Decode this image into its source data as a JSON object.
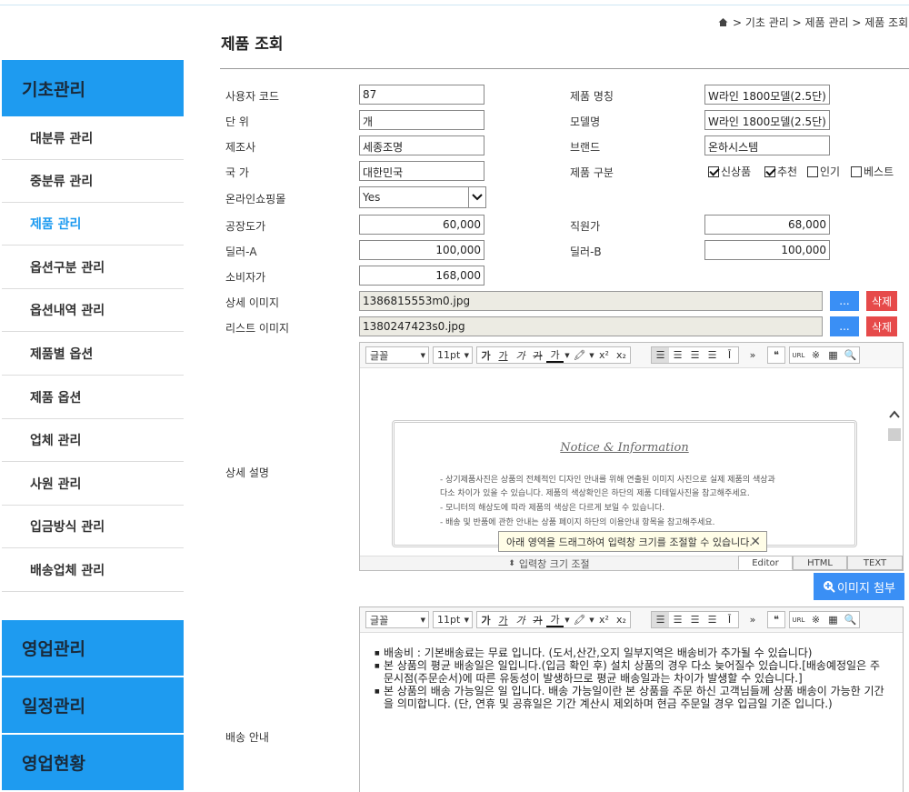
{
  "breadcrumb": {
    "items": [
      "기초 관리",
      "제품 관리",
      "제품 조회"
    ]
  },
  "page_title": "제품 조회",
  "sidebar": {
    "sections": [
      {
        "label": "기초관리"
      },
      {
        "label": "영업관리"
      },
      {
        "label": "일정관리"
      },
      {
        "label": "영업현황"
      }
    ],
    "items": [
      {
        "label": "대분류 관리"
      },
      {
        "label": "중분류 관리"
      },
      {
        "label": "제품 관리"
      },
      {
        "label": "옵션구분 관리"
      },
      {
        "label": "옵션내역 관리"
      },
      {
        "label": "제품별 옵션"
      },
      {
        "label": "제품 옵션"
      },
      {
        "label": "업체 관리"
      },
      {
        "label": "사원 관리"
      },
      {
        "label": "입금방식 관리"
      },
      {
        "label": "배송업체 관리"
      }
    ]
  },
  "form": {
    "user_code": {
      "label": "사용자 코드",
      "value": "87"
    },
    "unit": {
      "label": "단 위",
      "value": "개"
    },
    "maker": {
      "label": "제조사",
      "value": "세종조명"
    },
    "country": {
      "label": "국 가",
      "value": "대한민국"
    },
    "online_mall": {
      "label": "온라인쇼핑몰",
      "value": "Yes"
    },
    "factory_price": {
      "label": "공장도가",
      "value": "60,000"
    },
    "dealer_a": {
      "label": "딜러-A",
      "value": "100,000"
    },
    "consumer_price": {
      "label": "소비자가",
      "value": "168,000"
    },
    "product_name": {
      "label": "제품 명칭",
      "value": "W라인 1800모델(2.5단) ·"
    },
    "model_name": {
      "label": "모델명",
      "value": "W라인 1800모델(2.5단) ·"
    },
    "brand": {
      "label": "브랜드",
      "value": "온하시스템"
    },
    "product_type": {
      "label": "제품 구분",
      "options": [
        {
          "label": "신상품",
          "checked": true
        },
        {
          "label": "추천",
          "checked": true
        },
        {
          "label": "인기",
          "checked": false
        },
        {
          "label": "베스트",
          "checked": false
        }
      ]
    },
    "staff_price": {
      "label": "직원가",
      "value": "68,000"
    },
    "dealer_b": {
      "label": "딜러-B",
      "value": "100,000"
    },
    "detail_image": {
      "label": "상세 이미지",
      "value": "1386815553m0.jpg",
      "browse": "...",
      "delete": "삭제"
    },
    "list_image": {
      "label": "리스트 이미지",
      "value": "1380247423s0.jpg",
      "browse": "...",
      "delete": "삭제"
    },
    "detail_desc": {
      "label": "상세 설명"
    },
    "shipping_info": {
      "label": "배송 안내"
    },
    "attach_image": "이미지 첨부"
  },
  "editor": {
    "font": "글꼴",
    "size": "11pt",
    "notice_title": "Notice & Information",
    "notice_lines": [
      "- 상기제품사진은 상품의 전체적인 디자인 안내를 위해 연출된 이미지 사진으로 실제 제품의 색상과",
      "  다소 차이가 있을 수 있습니다. 제품의 색상확인은 하단의 제품 디테일사진을 참고해주세요.",
      "- 모니터의 해상도에 따라 제품의 색상은 다르게 보일 수 있습니다.",
      "- 배송 및 반품에 관한 안내는 상품 페이지 하단의 이용안내 항목을 참고해주세요."
    ],
    "tooltip": "아래 영역을 드래그하여 입력창 크기를 조절할 수 있습니다.",
    "resize_label": "입력창 크기 조절",
    "tabs": [
      "Editor",
      "HTML",
      "TEXT"
    ],
    "tb_glyphs": [
      "가",
      "가",
      "가",
      "가",
      "가",
      "가",
      "가",
      "가"
    ]
  },
  "shipping_lines": [
    "배송비 : 기본배송료는 무료 입니다. (도서,산간,오지 일부지역은 배송비가 추가될 수 있습니다)",
    "본 상품의 평균 배송일은 일입니다.(입금 확인 후) 설치 상품의 경우 다소 늦어질수 있습니다.[배송예정일은 주문시점(주문순서)에 따른 유동성이 발생하므로 평균 배송일과는 차이가 발생할 수 있습니다.]",
    "본 상품의 배송 가능일은 일 입니다. 배송 가능일이란 본 상품을 주문 하신 고객님들께 상품 배송이 가능한 기간을 의미합니다. (단, 연휴 및 공휴일은 기간 계산시 제외하며 현금 주문일 경우 입금일 기준 입니다.)"
  ]
}
